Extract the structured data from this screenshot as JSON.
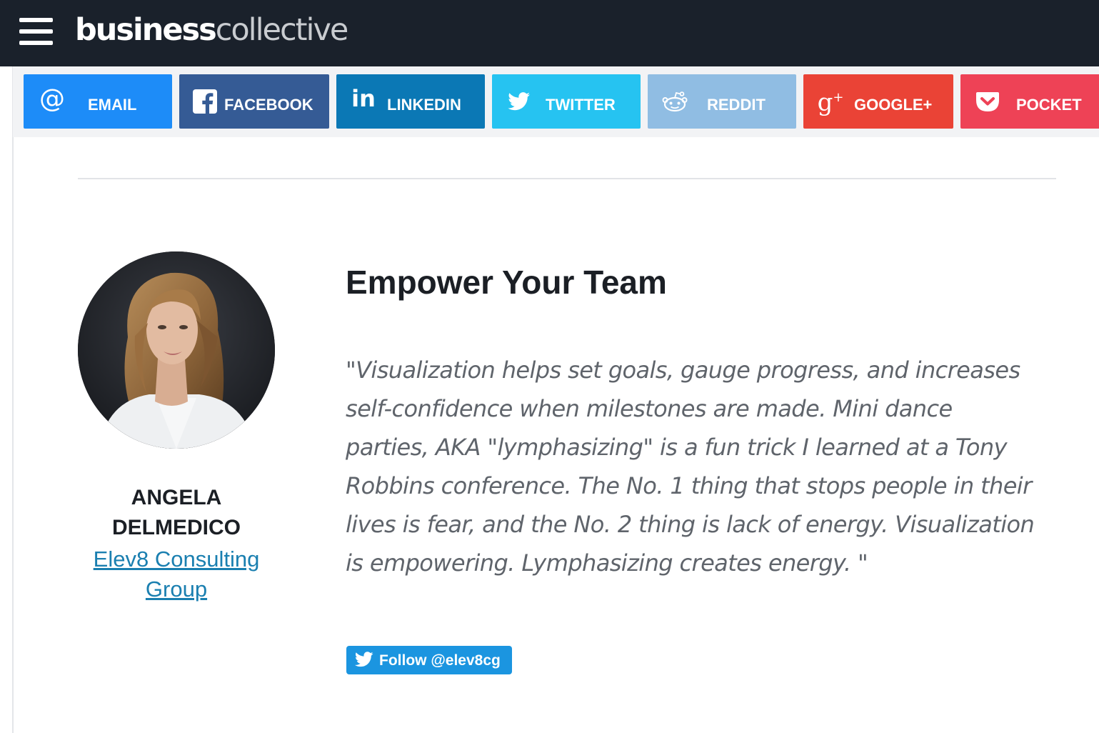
{
  "header": {
    "logo_bold": "business",
    "logo_light": "collective"
  },
  "share": {
    "email": {
      "label": "EMAIL",
      "color": "#1d8cf8"
    },
    "facebook": {
      "label": "FACEBOOK",
      "color": "#355b95"
    },
    "linkedin": {
      "label": "LINKEDIN",
      "color": "#0b78b5"
    },
    "twitter": {
      "label": "TWITTER",
      "color": "#26c3f1"
    },
    "reddit": {
      "label": "REDDIT",
      "color": "#90bde3"
    },
    "googleplus": {
      "label": "GOOGLE+",
      "color": "#ea4336"
    },
    "pocket": {
      "label": "POCKET",
      "color": "#ee4256"
    }
  },
  "author": {
    "name": "ANGELA DELMEDICO",
    "company": "Elev8 Consulting Group"
  },
  "article": {
    "heading": "Empower Your Team",
    "quote": "\"Visualization helps set goals, gauge progress, and increases self-confidence when milestones are made. Mini dance parties, AKA \"lymphasizing\" is a fun trick I learned at a Tony Robbins conference. The No. 1 thing that stops people in their lives is fear, and the No. 2 thing is lack of energy. Visualization is empowering. Lymphasizing creates energy. \""
  },
  "follow": {
    "label": "Follow @elev8cg"
  }
}
